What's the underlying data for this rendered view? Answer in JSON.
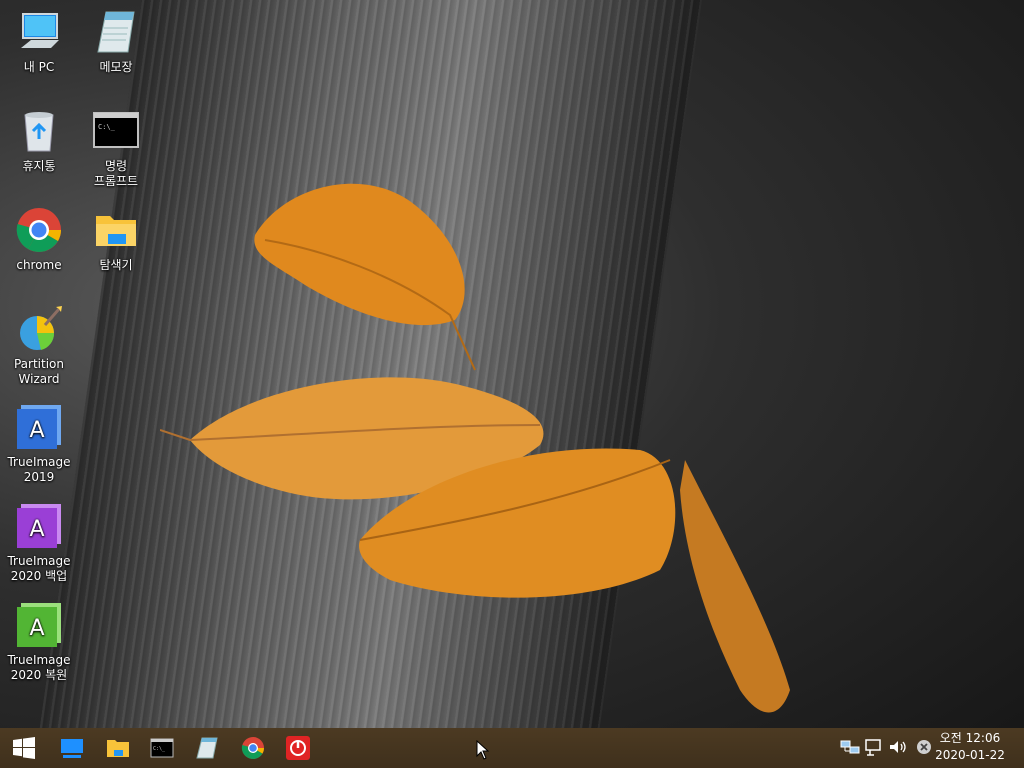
{
  "desktop": {
    "icons": [
      {
        "label": "내 PC",
        "icon": "computer-icon"
      },
      {
        "label": "메모장",
        "icon": "notepad-icon"
      },
      {
        "label": "휴지통",
        "icon": "recycle-bin-icon"
      },
      {
        "label": "명령\n프롬프트",
        "icon": "command-prompt-icon"
      },
      {
        "label": "chrome",
        "icon": "chrome-icon"
      },
      {
        "label": "탐색기",
        "icon": "folder-icon"
      },
      {
        "label": "Partition\nWizard",
        "icon": "partition-wizard-icon"
      },
      {
        "label": "TrueImage\n2019",
        "icon": "trueimage-icon"
      },
      {
        "label": "TrueImage\n2020 백업",
        "icon": "trueimage-icon"
      },
      {
        "label": "TrueImage\n2020 복원",
        "icon": "trueimage-icon"
      }
    ]
  },
  "taskbar": {
    "start": "windows-start-icon",
    "pinned": [
      "desktop-icon",
      "file-explorer-icon",
      "command-prompt-icon",
      "notepad-icon",
      "chrome-icon",
      "power-icon"
    ],
    "tray": [
      "network-icon",
      "ethernet-icon",
      "volume-icon",
      "close-circle-icon"
    ],
    "clock": {
      "time": "오전 12:06",
      "date": "2020-01-22"
    }
  },
  "colors": {
    "taskbar": "#45341f",
    "trueimage_2019": "#2f6fd8",
    "trueimage_2020_backup": "#9a3fd6",
    "trueimage_2020_restore": "#52b534"
  }
}
